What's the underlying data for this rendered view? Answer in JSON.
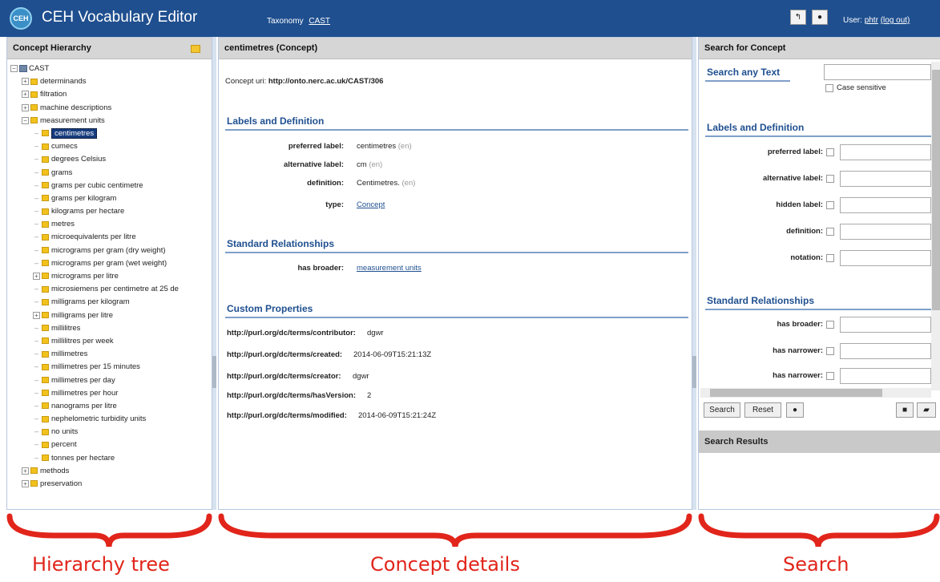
{
  "header": {
    "app_title": "CEH Vocabulary Editor",
    "logo_text": "CEH",
    "taxonomy_label": "Taxonomy",
    "taxonomy_value": "CAST",
    "user_label": "User:",
    "user_name": "phtr",
    "logout_label": "(log out)"
  },
  "hierarchy": {
    "title": "Concept Hierarchy",
    "root": "CAST",
    "top_items": [
      "determinands",
      "filtration",
      "machine descriptions",
      "measurement units"
    ],
    "unit_items": [
      "centimetres",
      "cumecs",
      "degrees Celsius",
      "grams",
      "grams per cubic centimetre",
      "grams per kilogram",
      "kilograms per hectare",
      "metres",
      "microequivalents per litre",
      "micrograms per gram (dry weight)",
      "micrograms per gram (wet weight)",
      "micrograms per litre",
      "microsiemens per centimetre at 25 de",
      "milligrams per kilogram",
      "milligrams per litre",
      "millilitres",
      "millilitres per week",
      "millimetres",
      "millimetres per 15 minutes",
      "millimetres per day",
      "millimetres per hour",
      "nanograms per litre",
      "nephelometric turbidity units",
      "no units",
      "percent",
      "tonnes per hectare"
    ],
    "bottom_items": [
      "methods",
      "preservation"
    ]
  },
  "concept": {
    "title": "centimetres (Concept)",
    "uri_label": "Concept uri:",
    "uri": "http://onto.nerc.ac.uk/CAST/306",
    "labels_section": "Labels and Definition",
    "preferred_label": "preferred label:",
    "preferred_value": "centimetres",
    "alternative_label": "alternative label:",
    "alternative_value": "cm",
    "definition_label": "definition:",
    "definition_value": "Centimetres.",
    "lang": "(en)",
    "type_label": "type:",
    "type_value": "Concept",
    "relationships_section": "Standard Relationships",
    "broader_label": "has broader:",
    "broader_value": "measurement units",
    "custom_section": "Custom Properties",
    "custom": [
      {
        "key": "http://purl.org/dc/terms/contributor:",
        "value": "dgwr"
      },
      {
        "key": "http://purl.org/dc/terms/created:",
        "value": "2014-06-09T15:21:13Z"
      },
      {
        "key": "http://purl.org/dc/terms/creator:",
        "value": "dgwr"
      },
      {
        "key": "http://purl.org/dc/terms/hasVersion:",
        "value": "2"
      },
      {
        "key": "http://purl.org/dc/terms/modified:",
        "value": "2014-06-09T15:21:24Z"
      }
    ]
  },
  "search": {
    "title": "Search for Concept",
    "any_text": "Search any Text",
    "case_sensitive": "Case sensitive",
    "labels_section": "Labels and Definition",
    "fields": [
      "preferred label:",
      "alternative label:",
      "hidden label:",
      "definition:",
      "notation:"
    ],
    "relationships_section": "Standard Relationships",
    "rel_fields": [
      "has broader:",
      "has narrower:",
      "has narrower:"
    ],
    "search_button": "Search",
    "reset_button": "Reset",
    "results_title": "Search Results"
  },
  "captions": {
    "left": "Hierarchy tree",
    "center": "Concept details",
    "right": "Search"
  },
  "colors": {
    "header_bg": "#1f4f8f",
    "accent": "#1f4f8f",
    "annotation": "#e1251b"
  }
}
